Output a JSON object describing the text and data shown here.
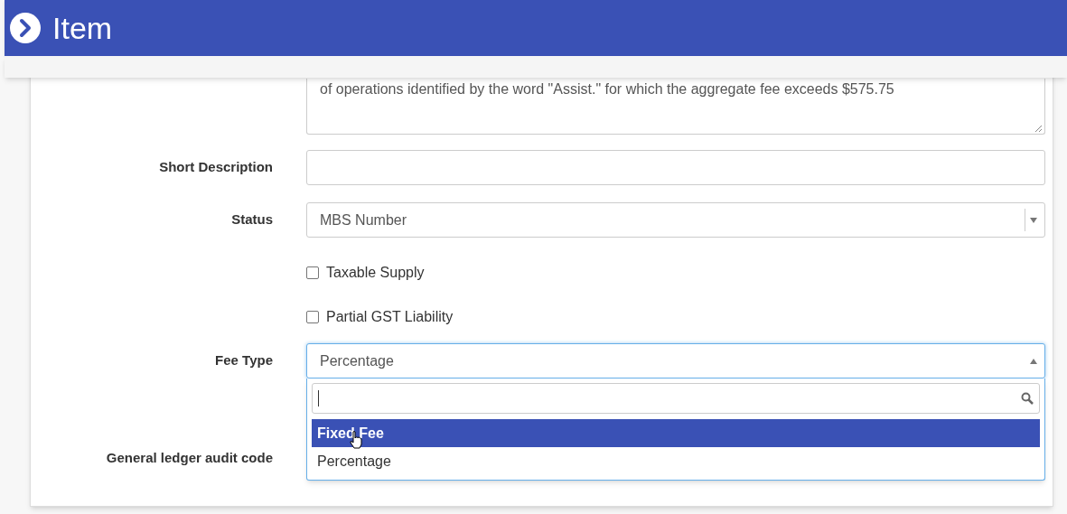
{
  "header": {
    "title": "Item"
  },
  "form": {
    "description_text": "of operations identified by the word \"Assist.\" for which the aggregate fee exceeds $575.75",
    "short_description": {
      "label": "Short Description"
    },
    "status": {
      "label": "Status",
      "value": "MBS Number"
    },
    "checkboxes": [
      {
        "label": "Taxable Supply",
        "checked": false
      },
      {
        "label": "Partial GST Liability",
        "checked": false
      }
    ],
    "fee_type": {
      "label": "Fee Type",
      "value": "Percentage",
      "expanded": true,
      "options": [
        {
          "label": "Fixed Fee",
          "highlighted": true
        },
        {
          "label": "Percentage",
          "highlighted": false
        }
      ]
    },
    "general_ledger": {
      "label": "General ledger audit code"
    }
  }
}
